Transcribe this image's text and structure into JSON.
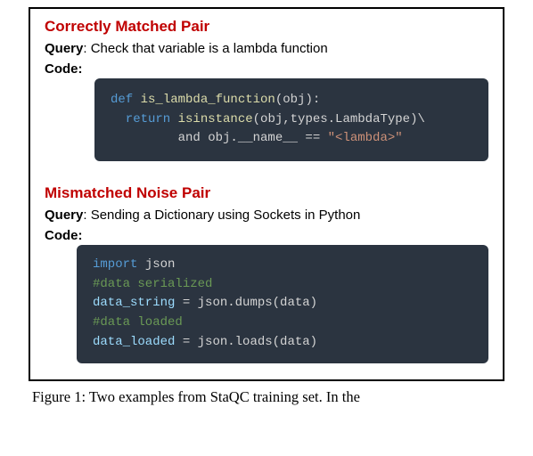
{
  "section1": {
    "title": "Correctly Matched Pair",
    "query_label": "Query",
    "query_text": ":  Check that variable is a lambda function",
    "code_label": "Code:",
    "code": {
      "l1a": "def ",
      "l1b": "is_lambda_function",
      "l1c": "(obj):",
      "l2a": "  return ",
      "l2b": "isinstance",
      "l2c": "(obj,types.LambdaType)\\",
      "l3a": "         and obj.__name__ == ",
      "l3b": "\"<lambda>\""
    }
  },
  "section2": {
    "title": "Mismatched Noise Pair",
    "query_label": "Query",
    "query_text": ":  Sending a Dictionary using Sockets in Python",
    "code_label": "Code:",
    "code": {
      "l1a": "import",
      "l1b": " json",
      "l2": "#data serialized",
      "l3a": "data_string ",
      "l3b": "= ",
      "l3c": "json.dumps(data)",
      "l4": "#data loaded",
      "l5a": "data_loaded ",
      "l5b": "= ",
      "l5c": "json.loads(data)"
    }
  },
  "caption_text": "Figure 1: Two examples from StaQC training set. In the"
}
